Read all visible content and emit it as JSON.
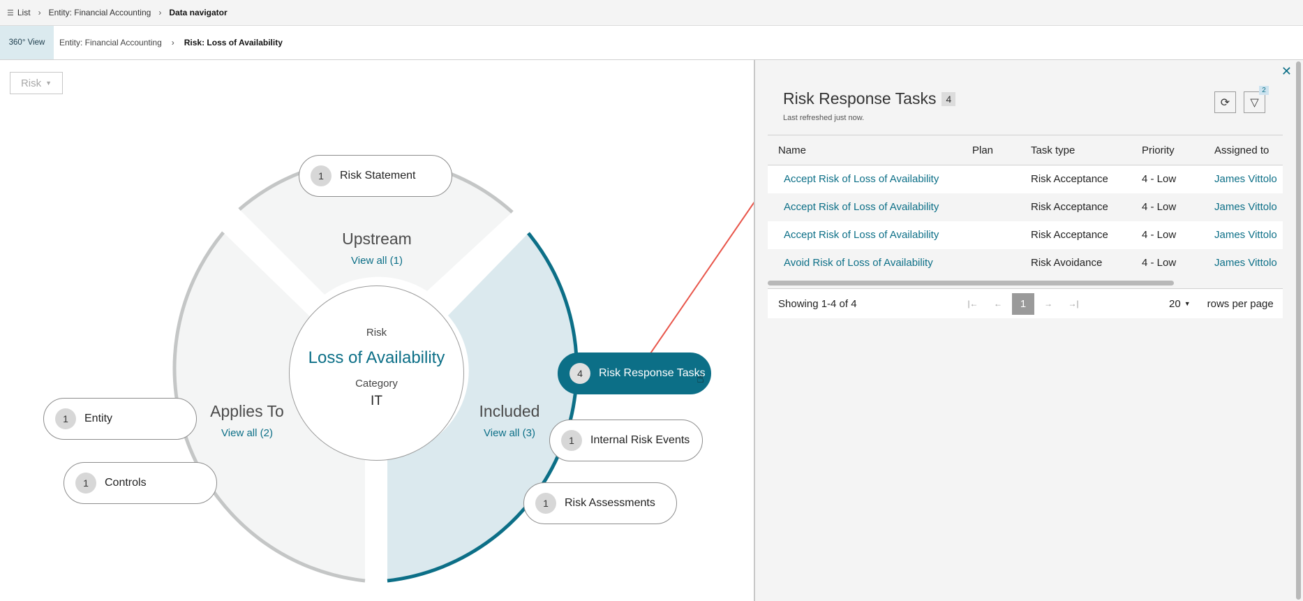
{
  "breadcrumb_top": {
    "list": "List",
    "entity": "Entity: Financial Accounting",
    "current": "Data navigator"
  },
  "breadcrumb_nav": {
    "view_tab": "360° View",
    "entity": "Entity: Financial Accounting",
    "current": "Risk: Loss of Availability"
  },
  "risk_dropdown": {
    "label": "Risk"
  },
  "center": {
    "type_label": "Risk",
    "name": "Loss of Availability",
    "category_label": "Category",
    "category_value": "IT"
  },
  "segments": {
    "upstream": {
      "title": "Upstream",
      "view_all": "View all (1)"
    },
    "applies_to": {
      "title": "Applies To",
      "view_all": "View all (2)"
    },
    "included": {
      "title": "Included",
      "view_all": "View all (3)"
    }
  },
  "nodes": {
    "risk_statement": {
      "count": "1",
      "label": "Risk Statement"
    },
    "entity": {
      "count": "1",
      "label": "Entity"
    },
    "controls": {
      "count": "1",
      "label": "Controls"
    },
    "risk_response_tasks": {
      "count": "4",
      "label": "Risk Response Tasks"
    },
    "internal_risk_events": {
      "count": "1",
      "label": "Internal Risk Events"
    },
    "risk_assessments": {
      "count": "1",
      "label": "Risk Assessments"
    }
  },
  "panel": {
    "title": "Risk Response Tasks",
    "count": "4",
    "subtitle": "Last refreshed just now.",
    "filter_count": "2",
    "columns": [
      "Name",
      "Plan",
      "Task type",
      "Priority",
      "Assigned to"
    ],
    "rows": [
      {
        "name": "Accept Risk of Loss of Availability",
        "plan": "",
        "task_type": "Risk Acceptance",
        "priority": "4 - Low",
        "assigned_to": "James Vittolo"
      },
      {
        "name": "Accept Risk of Loss of Availability",
        "plan": "",
        "task_type": "Risk Acceptance",
        "priority": "4 - Low",
        "assigned_to": "James Vittolo"
      },
      {
        "name": "Accept Risk of Loss of Availability",
        "plan": "",
        "task_type": "Risk Acceptance",
        "priority": "4 - Low",
        "assigned_to": "James Vittolo"
      },
      {
        "name": "Avoid Risk of Loss of Availability",
        "plan": "",
        "task_type": "Risk Avoidance",
        "priority": "4 - Low",
        "assigned_to": "James Vittolo"
      }
    ],
    "pager": {
      "showing": "Showing 1-4 of 4",
      "page": "1",
      "rows_per_page_value": "20",
      "rows_per_page_label": "rows per page"
    }
  },
  "colors": {
    "accent": "#0c6f87",
    "included_fill": "#dbe9ee",
    "segment_fill": "#f4f5f5",
    "arrow": "#e8554a"
  },
  "icons": [
    "list-icon",
    "chevron-right-icon",
    "caret-down-icon",
    "close-icon",
    "refresh-icon",
    "filter-icon",
    "first-page-icon",
    "prev-page-icon",
    "next-page-icon",
    "last-page-icon",
    "pointer-cursor-icon"
  ]
}
